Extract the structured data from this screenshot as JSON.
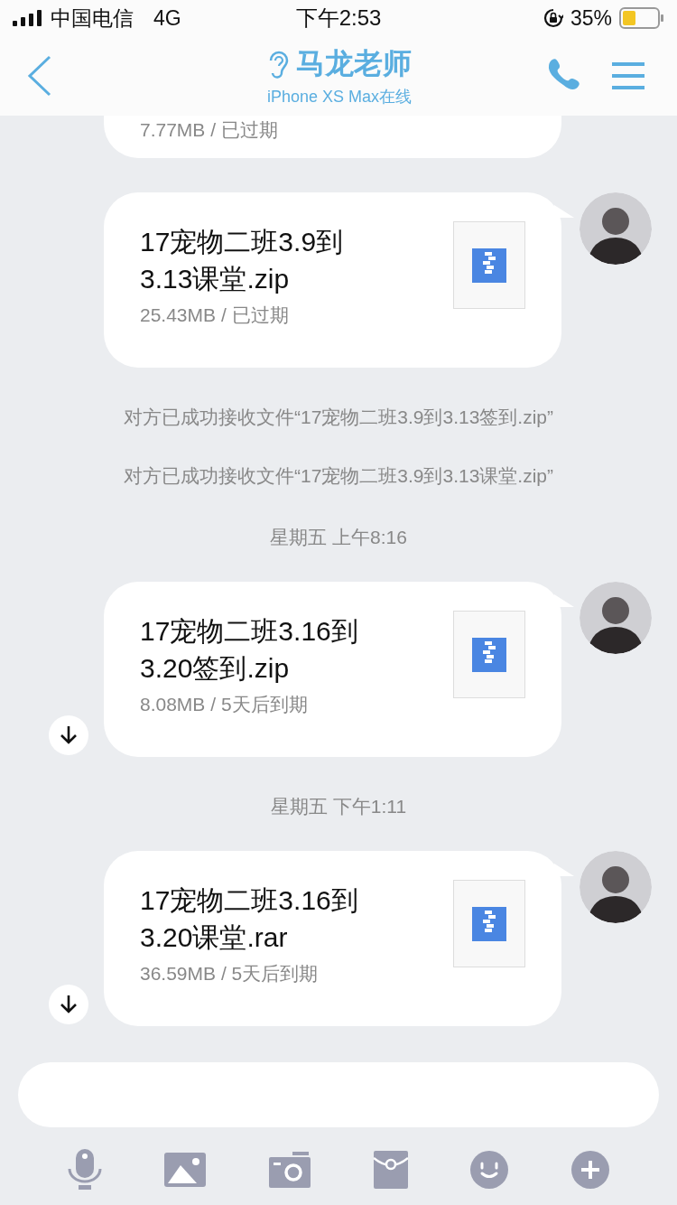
{
  "status_bar": {
    "carrier": "中国电信",
    "network": "4G",
    "time": "下午2:53",
    "battery": "35%"
  },
  "header": {
    "title": "马龙老师",
    "subtitle": "iPhone XS Max在线"
  },
  "messages": [
    {
      "kind": "file-tail",
      "meta": "7.77MB / 已过期"
    },
    {
      "kind": "file",
      "name": "17宠物二班3.9到3.13课堂.zip",
      "meta": "25.43MB / 已过期",
      "downloadable": false
    },
    {
      "kind": "notice",
      "text": "对方已成功接收文件“17宠物二班3.9到3.13签到.zip”"
    },
    {
      "kind": "notice",
      "text": "对方已成功接收文件“17宠物二班3.9到3.13课堂.zip”"
    },
    {
      "kind": "time",
      "text": "星期五 上午8:16"
    },
    {
      "kind": "file",
      "name": "17宠物二班3.16到3.20签到.zip",
      "meta": "8.08MB / 5天后到期",
      "downloadable": true
    },
    {
      "kind": "time",
      "text": "星期五 下午1:11"
    },
    {
      "kind": "file",
      "name": "17宠物二班3.16到3.20课堂.rar",
      "meta": "36.59MB / 5天后到期",
      "downloadable": true
    }
  ]
}
